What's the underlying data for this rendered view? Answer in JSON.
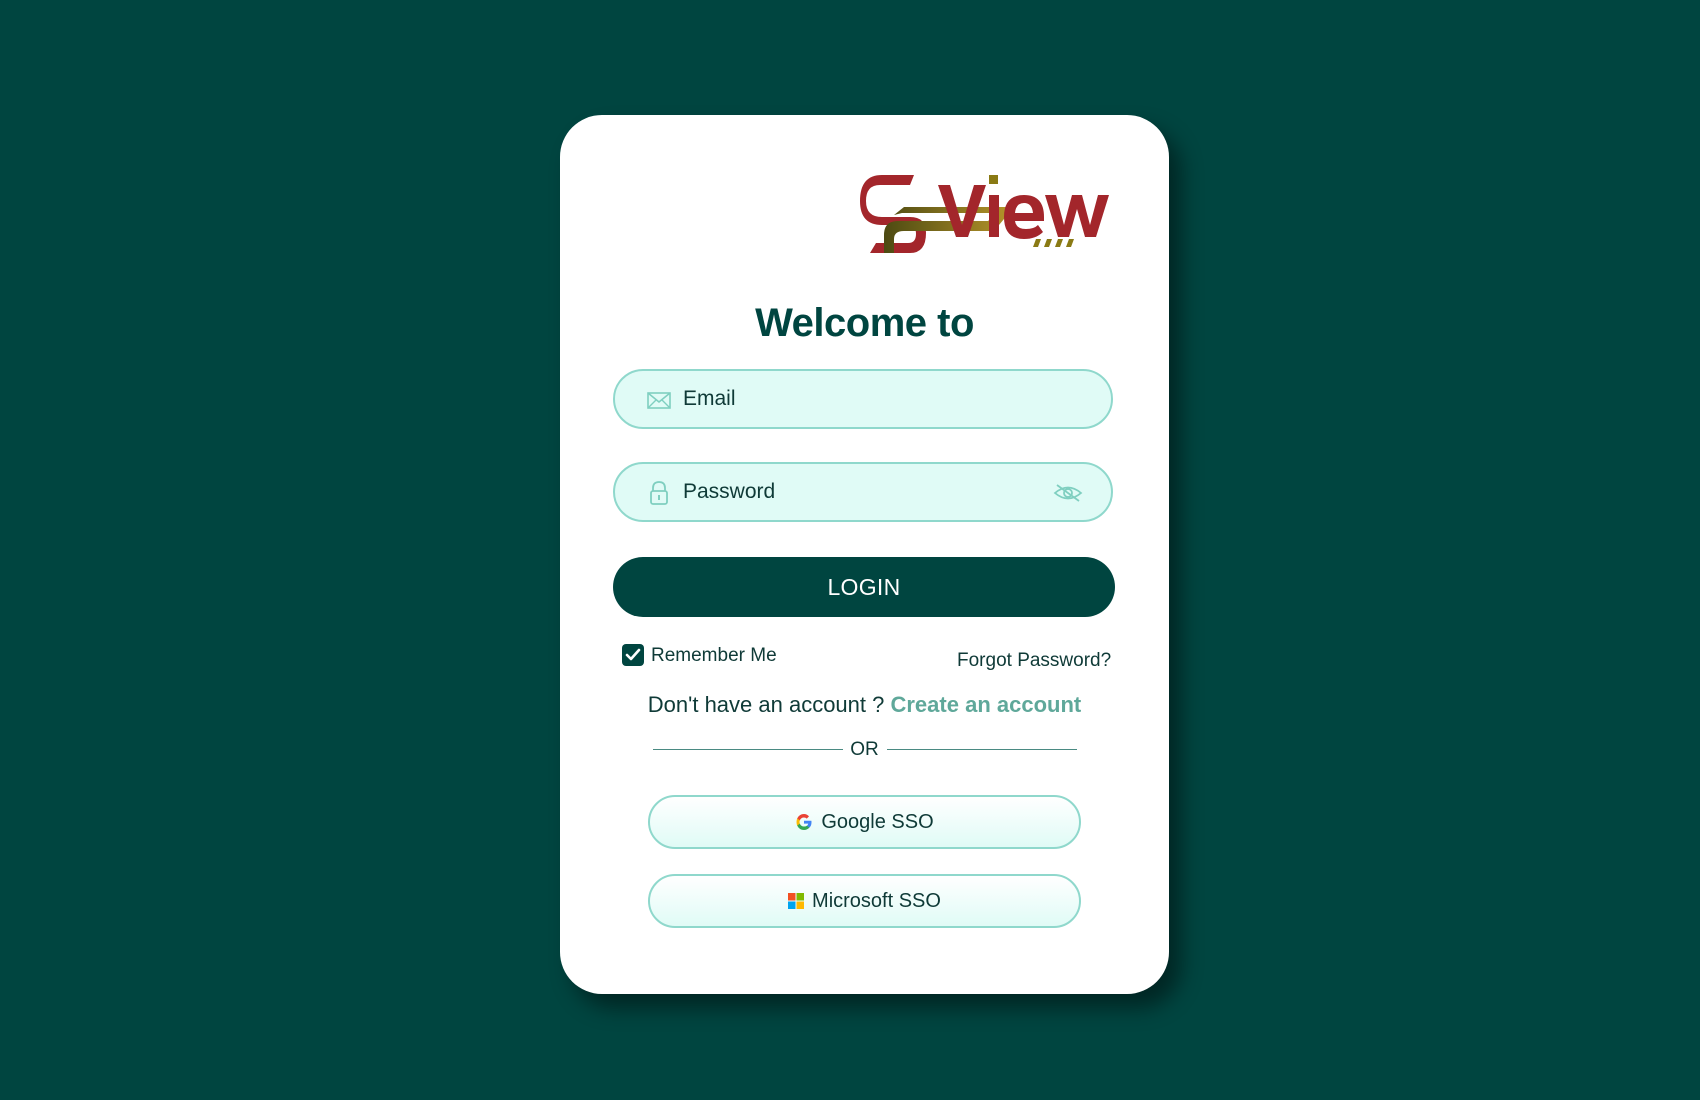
{
  "brand": {
    "logo_text": "SView",
    "colors": {
      "background": "#004540",
      "accent": "#004540",
      "field_fill": "#e0fbf6",
      "field_border": "#8fd8cc",
      "link": "#5fa89a",
      "logo_red": "#a3262b",
      "logo_gold": "#8a7a14"
    }
  },
  "header": {
    "welcome": "Welcome to"
  },
  "form": {
    "email": {
      "placeholder": "Email",
      "icon": "mail-icon"
    },
    "password": {
      "placeholder": "Password",
      "icon": "lock-icon",
      "toggle_icon": "eye-off-icon"
    },
    "login_label": "LOGIN",
    "remember_me": {
      "label": "Remember Me",
      "checked": true
    },
    "forgot_password": "Forgot Password?"
  },
  "signup": {
    "prompt": "Don't have an account ? ",
    "link": "Create an account"
  },
  "divider": {
    "label": "OR"
  },
  "sso": {
    "google": {
      "label": "Google SSO",
      "icon": "google-icon"
    },
    "microsoft": {
      "label": "Microsoft SSO",
      "icon": "microsoft-icon"
    }
  }
}
